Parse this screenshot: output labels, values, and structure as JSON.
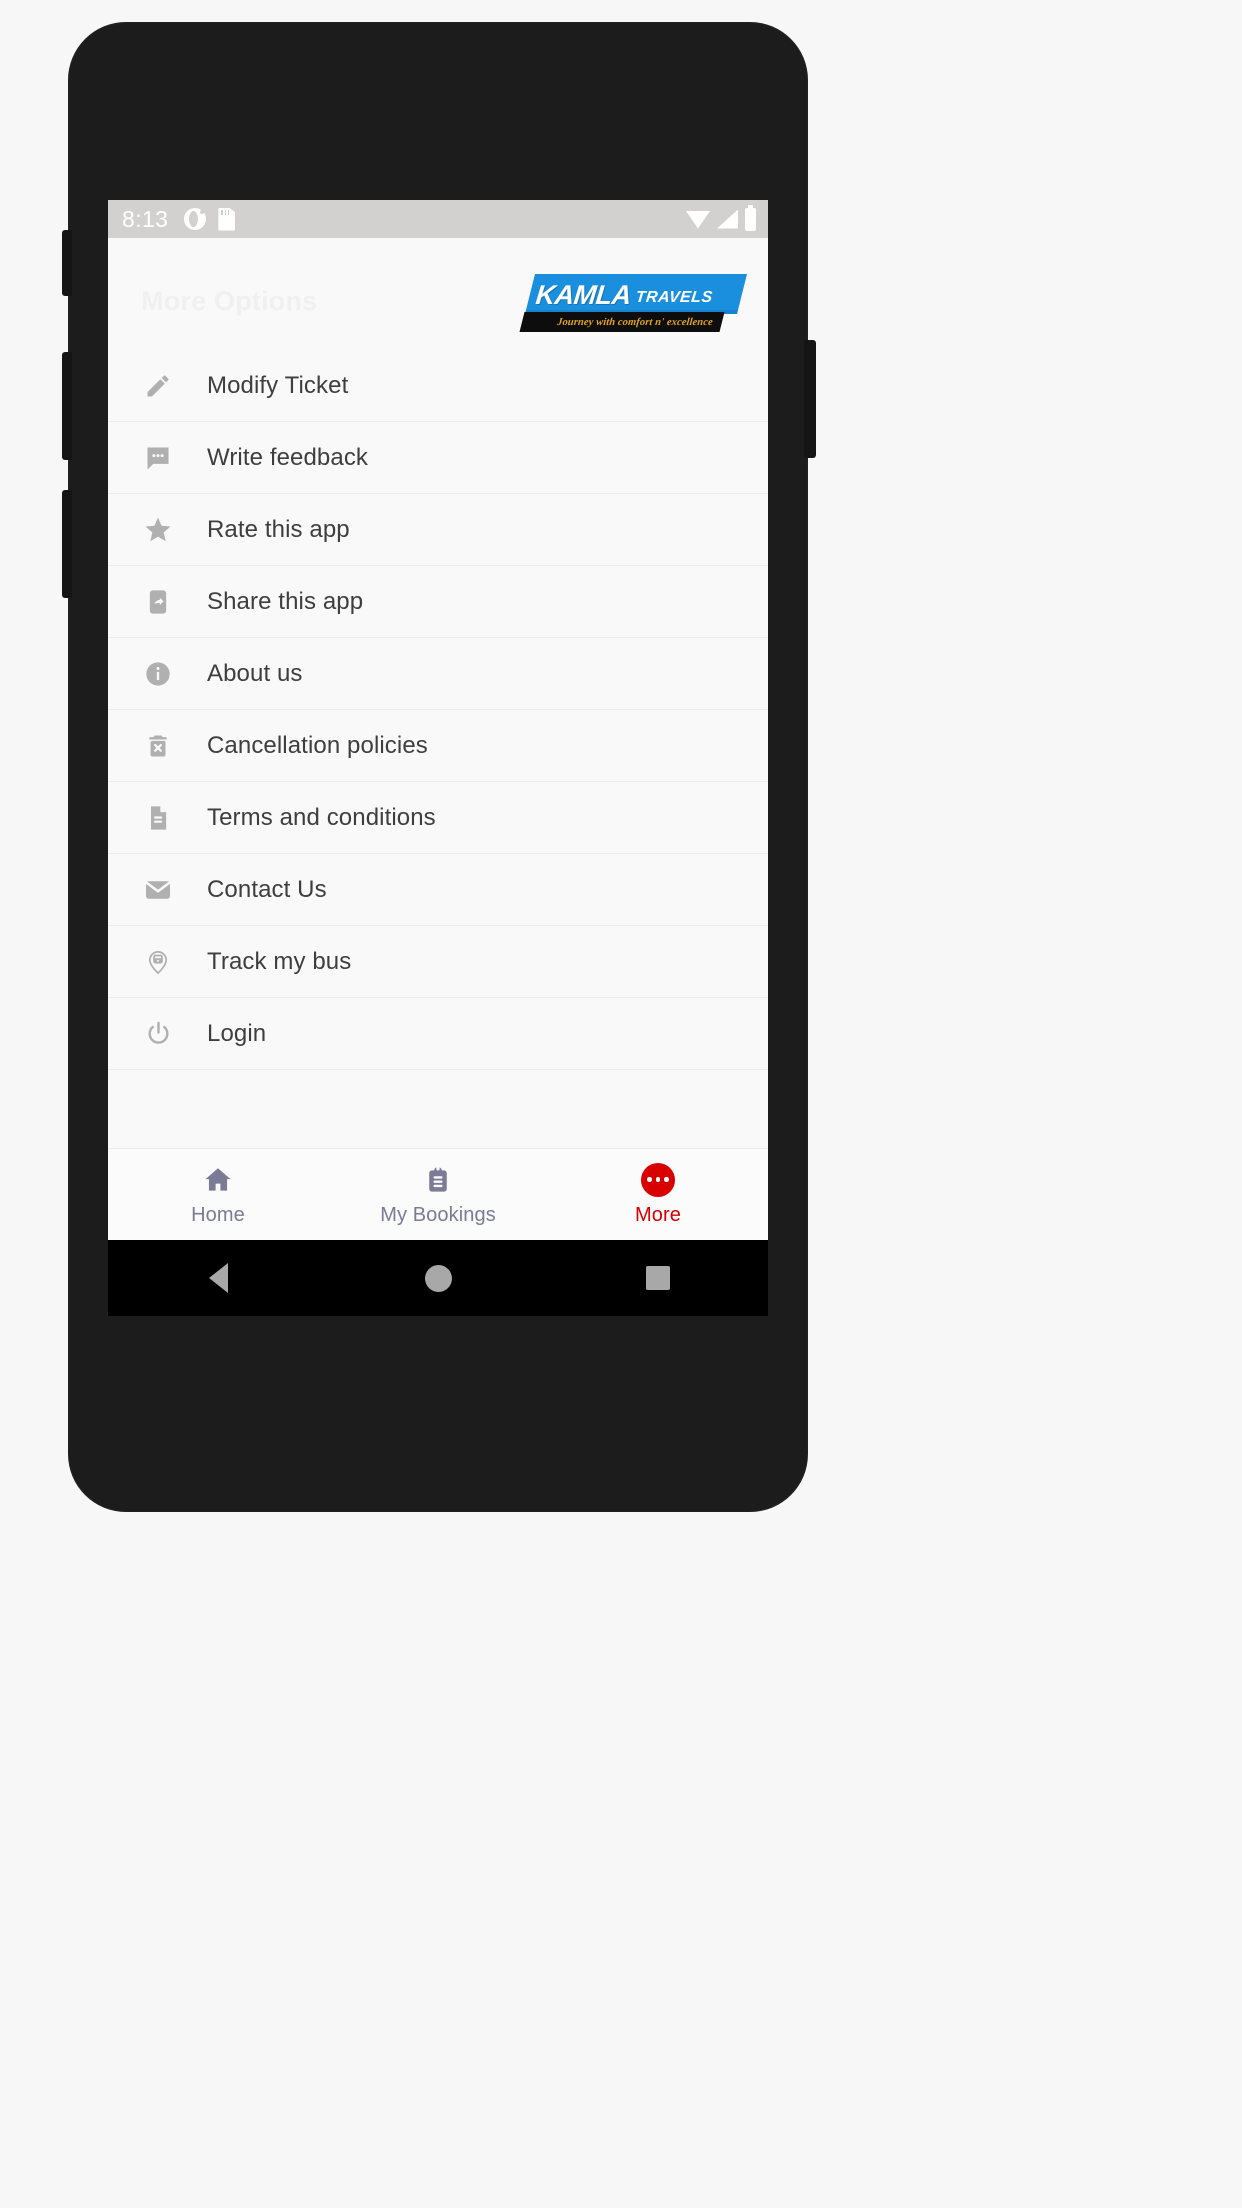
{
  "status_bar": {
    "time": "8:13",
    "left_icons": [
      "theme-toggle-icon",
      "sd-card-icon"
    ],
    "right_icons": [
      "wifi-icon",
      "cellular-signal-icon",
      "battery-icon"
    ]
  },
  "header": {
    "ghost_title": "More Options",
    "logo": {
      "main": "KAMLA",
      "sub": "TRAVELS",
      "tagline": "Journey with comfort n' excellence",
      "band_color": "#1a8fdd",
      "tagline_color": "#e5a417",
      "tag_band_color": "#0d0d0d"
    }
  },
  "menu": {
    "items": [
      {
        "label": "Modify Ticket",
        "icon": "pencil-icon"
      },
      {
        "label": "Write feedback",
        "icon": "chat-bubble-icon"
      },
      {
        "label": "Rate this app",
        "icon": "star-icon"
      },
      {
        "label": "Share this app",
        "icon": "share-phone-icon"
      },
      {
        "label": "About us",
        "icon": "info-icon"
      },
      {
        "label": "Cancellation policies",
        "icon": "trash-x-icon"
      },
      {
        "label": "Terms and conditions",
        "icon": "document-icon"
      },
      {
        "label": "Contact Us",
        "icon": "envelope-icon"
      },
      {
        "label": "Track my bus",
        "icon": "map-pin-bus-icon"
      },
      {
        "label": "Login",
        "icon": "power-icon"
      }
    ]
  },
  "tab_bar": {
    "active_color": "#d90000",
    "inactive_color": "#7b7b96",
    "tabs": [
      {
        "label": "Home",
        "icon": "home-icon",
        "active": false
      },
      {
        "label": "My Bookings",
        "icon": "clipboard-icon",
        "active": false
      },
      {
        "label": "More",
        "icon": "more-dots-icon",
        "active": true
      }
    ]
  },
  "android_nav": {
    "buttons": [
      "back-button",
      "home-button",
      "recents-button"
    ]
  }
}
